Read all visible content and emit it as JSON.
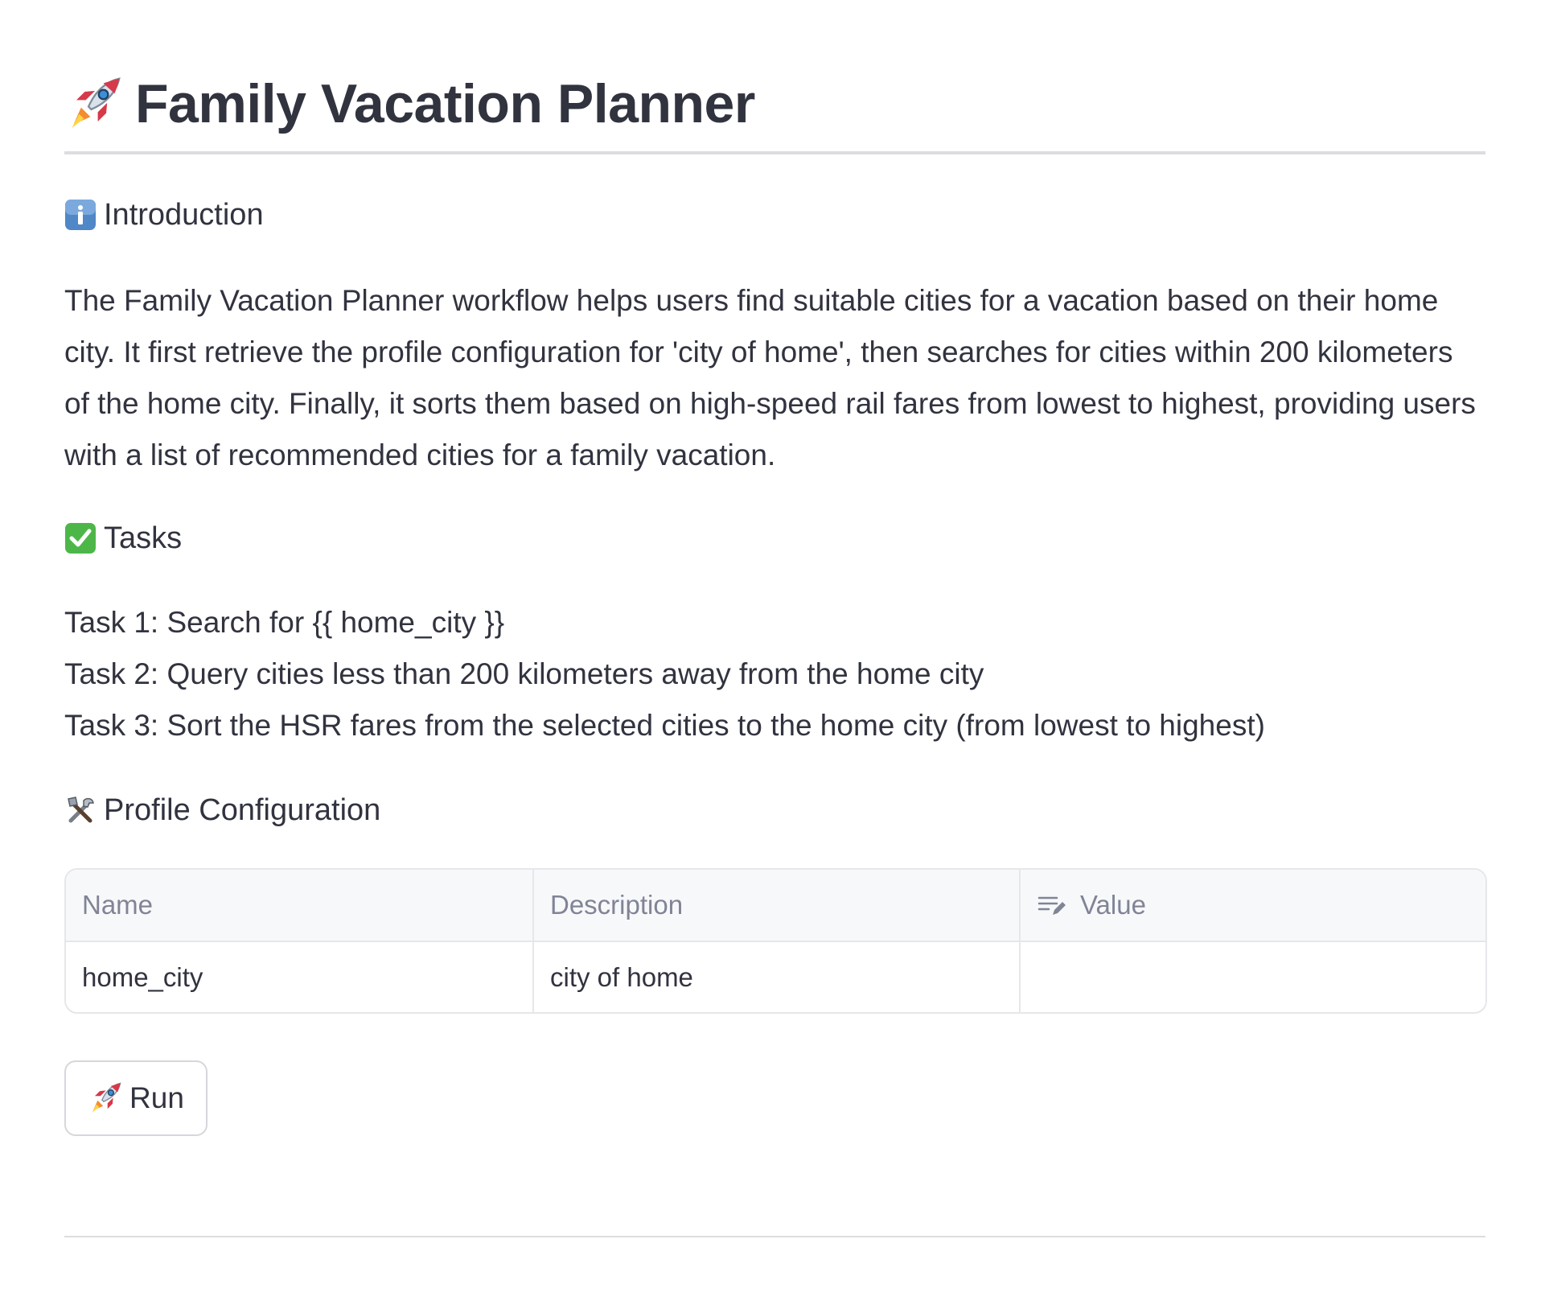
{
  "header": {
    "title": "Family Vacation Planner",
    "icon": "rocket-icon"
  },
  "introduction": {
    "heading": "Introduction",
    "icon": "information-icon",
    "text": "The Family Vacation Planner workflow helps users find suitable cities for a vacation based on their home city. It first retrieve the profile configuration for 'city of home', then searches for cities within 200 kilometers of the home city. Finally, it sorts them based on high-speed rail fares from lowest to highest, providing users with a list of recommended cities for a family vacation."
  },
  "tasks": {
    "heading": "Tasks",
    "icon": "check-box-icon",
    "items": [
      "Task 1: Search for {{ home_city }}",
      "Task 2: Query cities less than 200 kilometers away from the home city",
      "Task 3: Sort the HSR fares from the selected cities to the home city (from lowest to highest)"
    ]
  },
  "profile": {
    "heading": "Profile Configuration",
    "icon": "tools-icon",
    "table": {
      "columns": [
        "Name",
        "Description",
        "Value"
      ],
      "value_column_icon": "edit-column-icon",
      "rows": [
        {
          "name": "home_city",
          "description": "city of home",
          "value": ""
        }
      ]
    }
  },
  "actions": {
    "run_label": "Run",
    "run_icon": "rocket-icon"
  },
  "colors": {
    "text": "#31333f",
    "muted_text": "#808495",
    "divider": "#dcdde1",
    "table_border": "#e6e7ea",
    "table_header_bg": "#f7f8fa",
    "check_green": "#4cb748",
    "info_blue": "#4f87c7"
  }
}
